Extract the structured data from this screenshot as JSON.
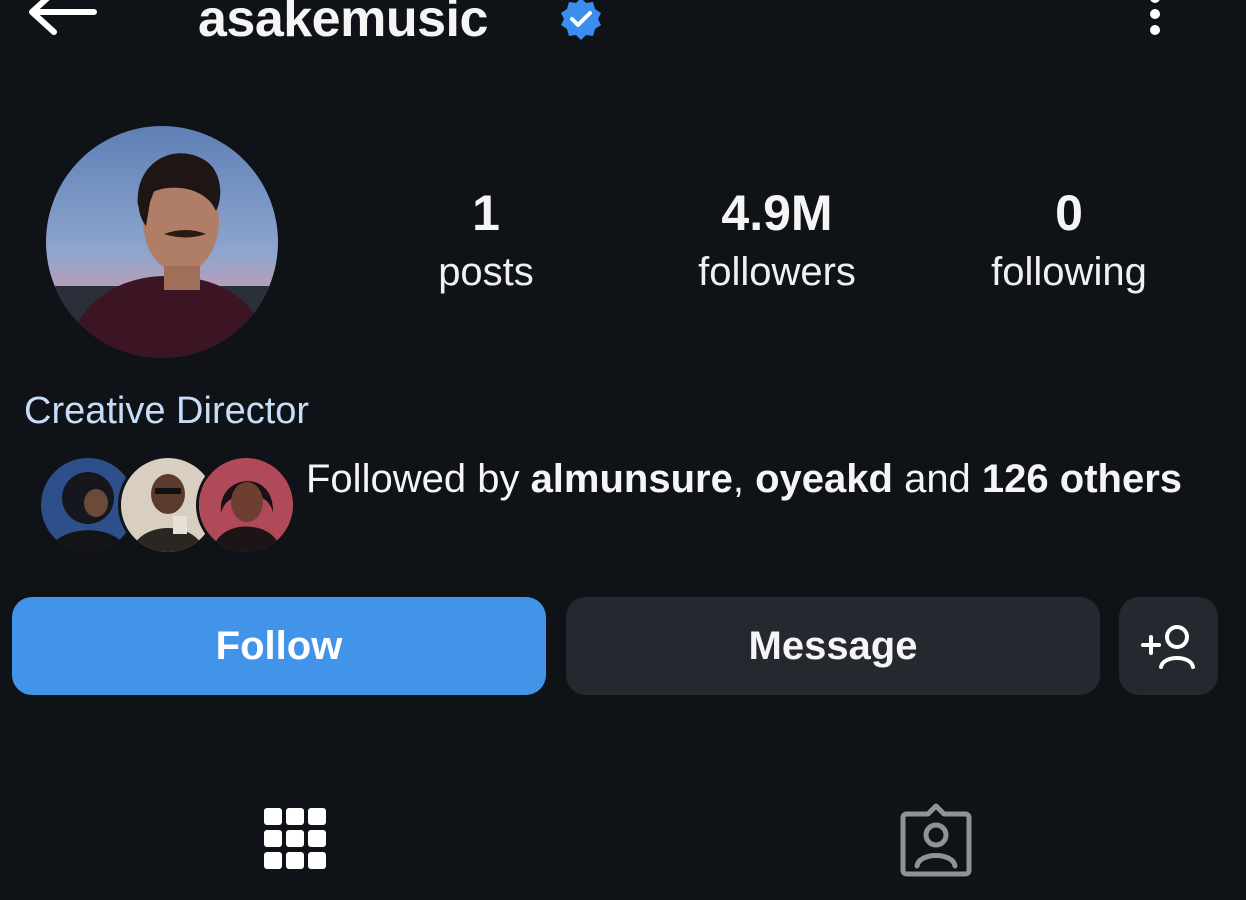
{
  "header": {
    "username": "asakemusic",
    "verified": true,
    "back_icon": "arrow-left-icon",
    "more_icon": "more-vertical-icon"
  },
  "profile": {
    "avatar_icon": "profile-photo",
    "stats": [
      {
        "value": "1",
        "label": "posts"
      },
      {
        "value": "4.9M",
        "label": "followers"
      },
      {
        "value": "0",
        "label": "following"
      }
    ],
    "bio": "Creative Director"
  },
  "followed_by": {
    "prefix": "Followed by ",
    "users": [
      "almunsure",
      "oyeakd"
    ],
    "separator": ", ",
    "middle": " and ",
    "count_text": "126 others"
  },
  "actions": {
    "follow_label": "Follow",
    "message_label": "Message",
    "add_user_icon": "add-person-icon"
  },
  "tabs": [
    {
      "name": "grid",
      "icon": "grid-icon",
      "selected": true
    },
    {
      "name": "tagged",
      "icon": "tagged-user-icon",
      "selected": false
    }
  ],
  "colors": {
    "background": "#0f1216",
    "follow_button": "#4294e8",
    "secondary_button": "#25282e",
    "verified_badge": "#3a8ef0",
    "bio_text": "#c7dcf7"
  }
}
